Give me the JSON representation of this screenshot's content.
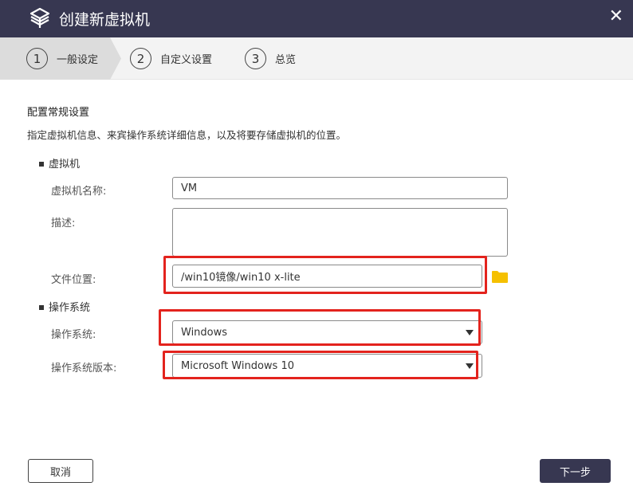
{
  "window": {
    "title": "创建新虚拟机",
    "logo_icon": "qnap-cube-icon",
    "close_icon": "close-icon",
    "close_glyph": "✕"
  },
  "steps": [
    {
      "num": "1",
      "label": "一般设定",
      "active": true
    },
    {
      "num": "2",
      "label": "自定义设置",
      "active": false
    },
    {
      "num": "3",
      "label": "总览",
      "active": false
    }
  ],
  "form": {
    "section_title": "配置常规设置",
    "section_desc": "指定虚拟机信息、来宾操作系统详细信息，以及将要存储虚拟机的位置。",
    "vm_group": "虚拟机",
    "vm_name_label": "虚拟机名称:",
    "vm_name_value": "VM",
    "desc_label": "描述:",
    "desc_value": "",
    "file_location_label": "文件位置:",
    "file_location_value": "/win10镜像/win10 x-lite",
    "folder_icon": "folder-icon",
    "os_group": "操作系统",
    "os_label": "操作系统:",
    "os_value": "Windows",
    "os_version_label": "操作系统版本:",
    "os_version_value": "Microsoft Windows 10"
  },
  "footer": {
    "cancel_label": "取消",
    "next_label": "下一步"
  },
  "colors": {
    "titlebar": "#373751",
    "highlight": "#e3231d",
    "folder": "#f5c000",
    "step_active_bg": "#dcdcdc"
  }
}
